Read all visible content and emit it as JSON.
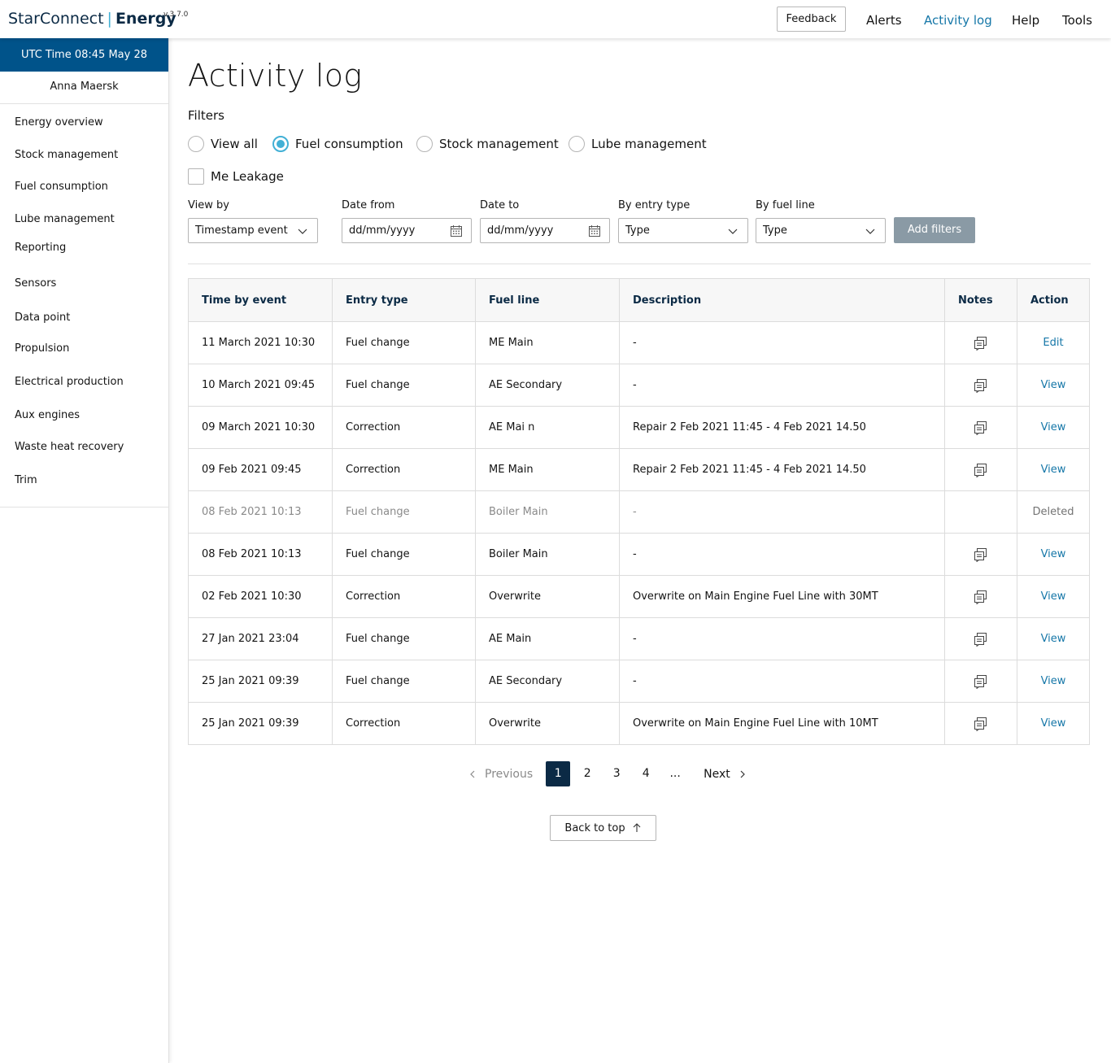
{
  "header": {
    "brand_main": "StarConnect",
    "brand_sep": "|",
    "brand_sub": "Energy",
    "version": "v.3.7.0",
    "feedback": "Feedback",
    "nav": [
      "Alerts",
      "Activity log",
      "Help",
      "Tools"
    ],
    "active_nav": "Activity log"
  },
  "sidebar": {
    "utc": "UTC Time 08:45 May 28",
    "user": "Anna Maersk",
    "items": [
      "Energy overview",
      "Stock management",
      "Fuel consumption",
      "Lube management",
      "Reporting",
      "Sensors",
      "Data point",
      "Propulsion",
      "Electrical production",
      "Aux engines",
      "Waste heat recovery",
      "Trim"
    ]
  },
  "page": {
    "title": "Activity log",
    "filters_label": "Filters",
    "radios": [
      "View all",
      "Fuel consumption",
      "Stock management",
      "Lube management"
    ],
    "selected_radio": "Fuel consumption",
    "checkbox": "Me Leakage",
    "fields": {
      "view_by_label": "View by",
      "view_by_value": "Timestamp event",
      "date_from_label": "Date from",
      "date_from_placeholder": "dd/mm/yyyy",
      "date_to_label": "Date to",
      "date_to_placeholder": "dd/mm/yyyy",
      "entry_type_label": "By entry type",
      "entry_type_value": "Type",
      "fuel_line_label": "By fuel line",
      "fuel_line_value": "Type"
    },
    "add_filters": "Add filters"
  },
  "table": {
    "columns": [
      "Time  by event",
      "Entry type",
      "Fuel line",
      "Description",
      "Notes",
      "Action"
    ],
    "rows": [
      {
        "time": "11 March 2021 10:30",
        "entry": "Fuel change",
        "line": "ME Main",
        "desc": "-",
        "notes": true,
        "action": "Edit",
        "deleted": false
      },
      {
        "time": "10 March 2021 09:45",
        "entry": "Fuel change",
        "line": "AE Secondary",
        "desc": "-",
        "notes": true,
        "action": "View",
        "deleted": false
      },
      {
        "time": "09 March 2021 10:30",
        "entry": "Correction",
        "line": "AE Mai n",
        "desc": "Repair 2 Feb 2021 11:45 - 4 Feb 2021 14.50",
        "notes": true,
        "action": "View",
        "deleted": false
      },
      {
        "time": "09 Feb 2021 09:45",
        "entry": "Correction",
        "line": "ME Main",
        "desc": "Repair 2 Feb 2021 11:45 - 4 Feb 2021 14.50",
        "notes": true,
        "action": "View",
        "deleted": false
      },
      {
        "time": "08 Feb 2021 10:13",
        "entry": "Fuel change",
        "line": "Boiler Main",
        "desc": "-",
        "notes": false,
        "action": "Deleted",
        "deleted": true
      },
      {
        "time": "08 Feb 2021 10:13",
        "entry": "Fuel change",
        "line": "Boiler Main",
        "desc": "-",
        "notes": true,
        "action": "View",
        "deleted": false
      },
      {
        "time": "02 Feb 2021 10:30",
        "entry": "Correction",
        "line": "Overwrite",
        "desc": "Overwrite on Main Engine Fuel Line with 30MT",
        "notes": true,
        "action": "View",
        "deleted": false
      },
      {
        "time": "27 Jan 2021 23:04",
        "entry": "Fuel change",
        "line": "AE Main",
        "desc": "-",
        "notes": true,
        "action": "View",
        "deleted": false
      },
      {
        "time": "25 Jan 2021 09:39",
        "entry": "Fuel change",
        "line": "AE Secondary",
        "desc": "-",
        "notes": true,
        "action": "View",
        "deleted": false
      },
      {
        "time": "25 Jan 2021 09:39",
        "entry": "Correction",
        "line": "Overwrite",
        "desc": "Overwrite on Main Engine Fuel Line with 10MT",
        "notes": true,
        "action": "View",
        "deleted": false
      }
    ]
  },
  "pagination": {
    "previous": "Previous",
    "pages": [
      "1",
      "2",
      "3",
      "4",
      "..."
    ],
    "current": "1",
    "next": "Next"
  },
  "back_to_top": "Back to top",
  "icons": {
    "calendar": "calendar-icon",
    "chevron_down": "chevron-down-icon",
    "notes": "notes-icon",
    "arrow_up": "arrow-up-icon"
  },
  "colors": {
    "primary_dark": "#0b2a45",
    "utc_bar": "#00538a",
    "accent": "#42b0d5",
    "link": "#1677a8",
    "disabled_button": "#8a9aa5"
  }
}
